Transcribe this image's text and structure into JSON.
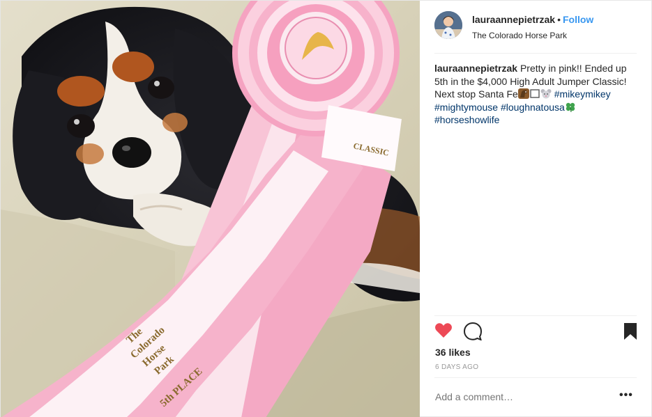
{
  "post": {
    "username": "lauraannepietrzak",
    "separator": "•",
    "follow_label": "Follow",
    "location": "The Colorado Horse Park",
    "caption": {
      "user": "lauraannepietrzak",
      "text_1": " Pretty in pink!! Ended up 5th in the $4,000 High Adult Jumper Classic! Next stop Santa Fe",
      "emoji": [
        "horse-icon",
        "white-square-icon",
        "mouse-face-icon"
      ],
      "hashtags_1": [
        "#mikeymikey",
        "#mightymouse",
        "#loughnatousa"
      ],
      "emoji_after": "four-leaf-clover-icon",
      "hashtags_2": [
        "#horseshowlife"
      ]
    },
    "likes": "36 likes",
    "time_ago": "6 DAYS AGO",
    "comment_placeholder": "Add a comment…",
    "more_label": "•••",
    "liked": true
  },
  "photo": {
    "ribbon_rosette_label": "CLASSIC",
    "ribbon_text_lines": [
      "The",
      "Colorado",
      "Horse",
      "Park"
    ],
    "ribbon_place": "5th PLACE"
  },
  "colors": {
    "heart": "#ed4956",
    "follow": "#3897f0",
    "hashtag": "#003569",
    "ribbon_pink": "#f7b8cf",
    "ribbon_white": "#fdf3f6"
  },
  "icons": {
    "like": "heart-icon",
    "comment": "comment-icon",
    "save": "bookmark-icon"
  }
}
